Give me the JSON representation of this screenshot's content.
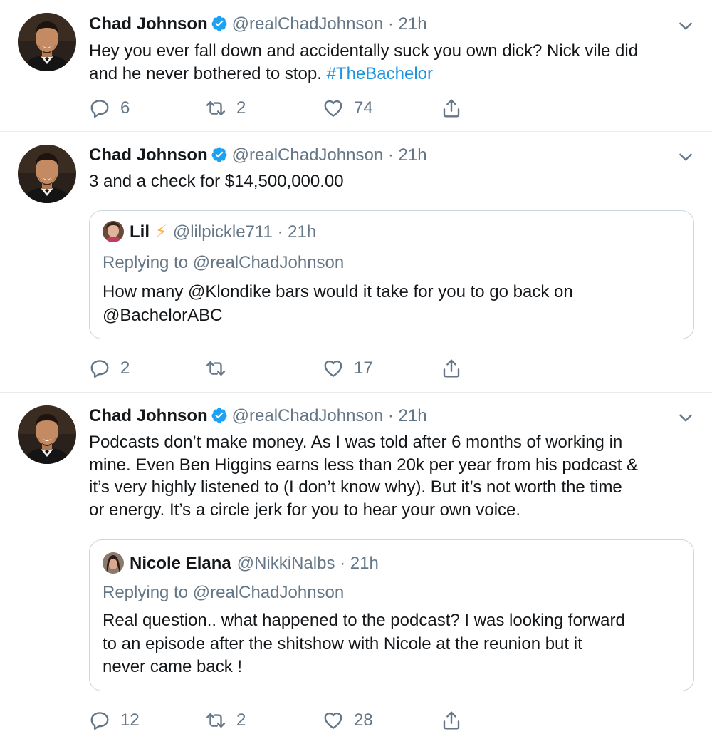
{
  "tweets": [
    {
      "author": {
        "name": "Chad Johnson",
        "handle": "@realChadJohnson",
        "time": "21h"
      },
      "text": {
        "line1": "Hey you ever fall down and accidentally suck you own dick? Nick vile did",
        "line2": "and he never bothered to stop. ",
        "hashtag": "#TheBachelor"
      },
      "stats": {
        "replies": "6",
        "retweets": "2",
        "likes": "74"
      }
    },
    {
      "author": {
        "name": "Chad Johnson",
        "handle": "@realChadJohnson",
        "time": "21h"
      },
      "text": {
        "line1": "3 and a check for $14,500,000.00"
      },
      "quote": {
        "name": "Lil",
        "emoji": "⚡",
        "handle": "@lilpickle711",
        "time": "21h",
        "replying": "Replying to @realChadJohnson",
        "line1": "How many @Klondike bars would it take for you to go back on",
        "line2": "@BachelorABC"
      },
      "stats": {
        "replies": "2",
        "retweets": "",
        "likes": "17"
      }
    },
    {
      "author": {
        "name": "Chad Johnson",
        "handle": "@realChadJohnson",
        "time": "21h"
      },
      "text": {
        "line1": "Podcasts don’t make money. As I was told after 6 months of working in",
        "line2": "mine. Even Ben Higgins earns less than 20k per year from his podcast &",
        "line3": "it’s very highly listened to (I don’t know why). But it’s not worth the time",
        "line4": "or energy. It’s a circle jerk for you to hear your own voice."
      },
      "quote": {
        "name": "Nicole Elana",
        "handle": "@NikkiNalbs",
        "time": "21h",
        "replying": "Replying to @realChadJohnson",
        "line1": "Real question.. what happened to the podcast? I was looking forward",
        "line2": "to an episode after the shitshow with Nicole at the reunion but it",
        "line3": "never came back !"
      },
      "stats": {
        "replies": "12",
        "retweets": "2",
        "likes": "28"
      }
    }
  ],
  "separator": " · ",
  "icons": {
    "verified": "verified-badge-icon",
    "caret": "chevron-down-icon",
    "reply": "reply-icon",
    "retweet": "retweet-icon",
    "like": "heart-icon",
    "share": "share-icon"
  },
  "colors": {
    "link": "#1b95e0",
    "secondary": "#657786",
    "verified": "#1da1f2",
    "border": "#ccd6dd",
    "lightning": "#ffac33"
  }
}
